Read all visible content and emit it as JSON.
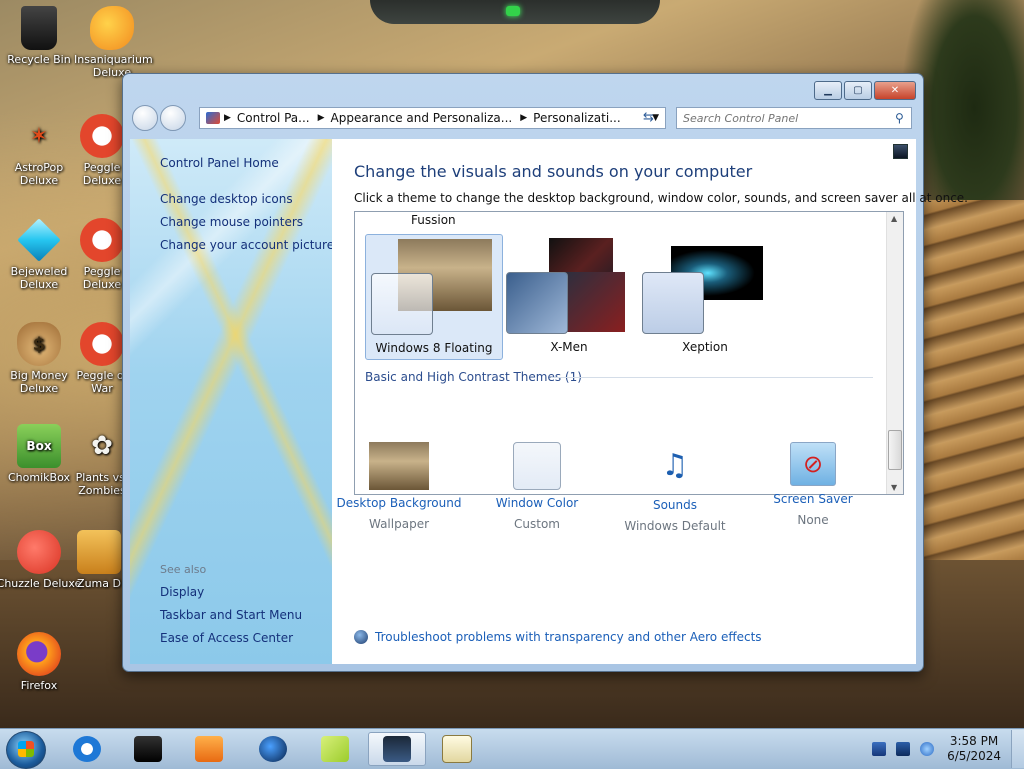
{
  "desktop": {
    "icons": [
      {
        "label": "Recycle Bin",
        "icon": "recycle-bin-icon",
        "color": "#222222"
      },
      {
        "label": "Insaniquarium Deluxe",
        "icon": "goldfish-icon",
        "color": "#f28a1e"
      },
      {
        "label": "AstroPop Deluxe",
        "icon": "astropop-icon",
        "color": "#e04b1a"
      },
      {
        "label": "Peggle Deluxe",
        "icon": "peggle-icon",
        "color": "#e3462c"
      },
      {
        "label": "Bejeweled Deluxe",
        "icon": "diamond-icon",
        "color": "#26c6f0"
      },
      {
        "label": "Peggle Deluxe",
        "icon": "peggle-icon",
        "color": "#e3462c"
      },
      {
        "label": "Big Money Deluxe",
        "icon": "money-bag-icon",
        "color": "#b8834a"
      },
      {
        "label": "Peggle of War",
        "icon": "peggle-icon",
        "color": "#e3462c"
      },
      {
        "label": "ChomikBox",
        "icon": "hamster-icon",
        "color": "#3b8f2c"
      },
      {
        "label": "Plants vs. Zombies",
        "icon": "flower-icon",
        "color": "#eef0ea"
      },
      {
        "label": "Chuzzle Deluxe",
        "icon": "chuzzle-icon",
        "color": "#d93323"
      },
      {
        "label": "Zuma D",
        "icon": "zuma-icon",
        "color": "#e7a22b"
      },
      {
        "label": "Firefox",
        "icon": "firefox-icon",
        "color": "#e8591d"
      }
    ]
  },
  "window": {
    "address": {
      "crumbs": [
        "Control Pa...",
        "Appearance and Personaliza...",
        "Personalizati..."
      ]
    },
    "search_placeholder": "Search Control Panel",
    "left_pane": {
      "home": "Control Panel Home",
      "links": [
        "Change desktop icons",
        "Change mouse pointers",
        "Change your account picture"
      ],
      "see_also_title": "See also",
      "see_also": [
        "Display",
        "Taskbar and Start Menu",
        "Ease of Access Center"
      ]
    },
    "content": {
      "heading": "Change the visuals and sounds on your computer",
      "subheading": "Click a theme to change the desktop background, window color, sounds, and screen saver all at once.",
      "partial_theme_label": "Fussion",
      "themes": [
        {
          "label": "Windows 8 Floating",
          "selected": true
        },
        {
          "label": "X-Men",
          "selected": false
        },
        {
          "label": "Xeption",
          "selected": false
        }
      ],
      "section_title": "Basic and High Contrast Themes (1)",
      "bottom_items": [
        {
          "link": "Desktop Background",
          "value": "Wallpaper",
          "icon": "wallpaper-thumbnail-icon"
        },
        {
          "link": "Window Color",
          "value": "Custom",
          "icon": "window-color-icon"
        },
        {
          "link": "Sounds",
          "value": "Windows Default",
          "icon": "sounds-icon"
        },
        {
          "link": "Screen Saver",
          "value": "None",
          "icon": "screen-saver-icon"
        }
      ],
      "trouble_link": "Troubleshoot problems with transparency and other Aero effects"
    }
  },
  "taskbar": {
    "apps": [
      {
        "icon": "internet-explorer-icon",
        "active": false
      },
      {
        "icon": "media-center-icon",
        "active": false
      },
      {
        "icon": "media-player-icon",
        "active": false
      },
      {
        "icon": "globe-icon",
        "active": false
      },
      {
        "icon": "sticky-notes-icon",
        "active": false
      },
      {
        "icon": "personalization-window-icon",
        "active": true
      },
      {
        "icon": "notepad-icon",
        "active": false
      }
    ],
    "time": "3:58 PM",
    "date": "6/5/2024"
  }
}
